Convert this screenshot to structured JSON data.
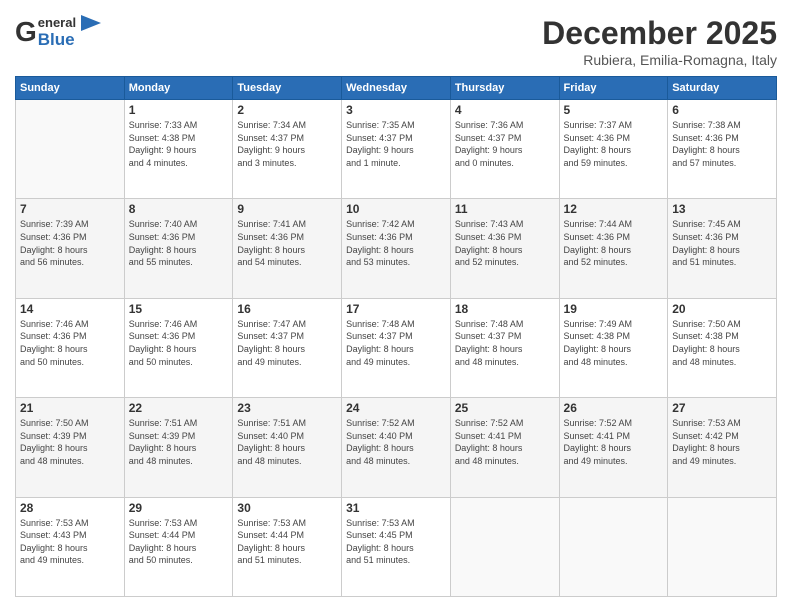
{
  "logo": {
    "g": "G",
    "eneral": "eneral",
    "blue": "Blue"
  },
  "title": "December 2025",
  "subtitle": "Rubiera, Emilia-Romagna, Italy",
  "days_header": [
    "Sunday",
    "Monday",
    "Tuesday",
    "Wednesday",
    "Thursday",
    "Friday",
    "Saturday"
  ],
  "weeks": [
    [
      {
        "num": "",
        "info": ""
      },
      {
        "num": "1",
        "info": "Sunrise: 7:33 AM\nSunset: 4:38 PM\nDaylight: 9 hours\nand 4 minutes."
      },
      {
        "num": "2",
        "info": "Sunrise: 7:34 AM\nSunset: 4:37 PM\nDaylight: 9 hours\nand 3 minutes."
      },
      {
        "num": "3",
        "info": "Sunrise: 7:35 AM\nSunset: 4:37 PM\nDaylight: 9 hours\nand 1 minute."
      },
      {
        "num": "4",
        "info": "Sunrise: 7:36 AM\nSunset: 4:37 PM\nDaylight: 9 hours\nand 0 minutes."
      },
      {
        "num": "5",
        "info": "Sunrise: 7:37 AM\nSunset: 4:36 PM\nDaylight: 8 hours\nand 59 minutes."
      },
      {
        "num": "6",
        "info": "Sunrise: 7:38 AM\nSunset: 4:36 PM\nDaylight: 8 hours\nand 57 minutes."
      }
    ],
    [
      {
        "num": "7",
        "info": "Sunrise: 7:39 AM\nSunset: 4:36 PM\nDaylight: 8 hours\nand 56 minutes."
      },
      {
        "num": "8",
        "info": "Sunrise: 7:40 AM\nSunset: 4:36 PM\nDaylight: 8 hours\nand 55 minutes."
      },
      {
        "num": "9",
        "info": "Sunrise: 7:41 AM\nSunset: 4:36 PM\nDaylight: 8 hours\nand 54 minutes."
      },
      {
        "num": "10",
        "info": "Sunrise: 7:42 AM\nSunset: 4:36 PM\nDaylight: 8 hours\nand 53 minutes."
      },
      {
        "num": "11",
        "info": "Sunrise: 7:43 AM\nSunset: 4:36 PM\nDaylight: 8 hours\nand 52 minutes."
      },
      {
        "num": "12",
        "info": "Sunrise: 7:44 AM\nSunset: 4:36 PM\nDaylight: 8 hours\nand 52 minutes."
      },
      {
        "num": "13",
        "info": "Sunrise: 7:45 AM\nSunset: 4:36 PM\nDaylight: 8 hours\nand 51 minutes."
      }
    ],
    [
      {
        "num": "14",
        "info": "Sunrise: 7:46 AM\nSunset: 4:36 PM\nDaylight: 8 hours\nand 50 minutes."
      },
      {
        "num": "15",
        "info": "Sunrise: 7:46 AM\nSunset: 4:36 PM\nDaylight: 8 hours\nand 50 minutes."
      },
      {
        "num": "16",
        "info": "Sunrise: 7:47 AM\nSunset: 4:37 PM\nDaylight: 8 hours\nand 49 minutes."
      },
      {
        "num": "17",
        "info": "Sunrise: 7:48 AM\nSunset: 4:37 PM\nDaylight: 8 hours\nand 49 minutes."
      },
      {
        "num": "18",
        "info": "Sunrise: 7:48 AM\nSunset: 4:37 PM\nDaylight: 8 hours\nand 48 minutes."
      },
      {
        "num": "19",
        "info": "Sunrise: 7:49 AM\nSunset: 4:38 PM\nDaylight: 8 hours\nand 48 minutes."
      },
      {
        "num": "20",
        "info": "Sunrise: 7:50 AM\nSunset: 4:38 PM\nDaylight: 8 hours\nand 48 minutes."
      }
    ],
    [
      {
        "num": "21",
        "info": "Sunrise: 7:50 AM\nSunset: 4:39 PM\nDaylight: 8 hours\nand 48 minutes."
      },
      {
        "num": "22",
        "info": "Sunrise: 7:51 AM\nSunset: 4:39 PM\nDaylight: 8 hours\nand 48 minutes."
      },
      {
        "num": "23",
        "info": "Sunrise: 7:51 AM\nSunset: 4:40 PM\nDaylight: 8 hours\nand 48 minutes."
      },
      {
        "num": "24",
        "info": "Sunrise: 7:52 AM\nSunset: 4:40 PM\nDaylight: 8 hours\nand 48 minutes."
      },
      {
        "num": "25",
        "info": "Sunrise: 7:52 AM\nSunset: 4:41 PM\nDaylight: 8 hours\nand 48 minutes."
      },
      {
        "num": "26",
        "info": "Sunrise: 7:52 AM\nSunset: 4:41 PM\nDaylight: 8 hours\nand 49 minutes."
      },
      {
        "num": "27",
        "info": "Sunrise: 7:53 AM\nSunset: 4:42 PM\nDaylight: 8 hours\nand 49 minutes."
      }
    ],
    [
      {
        "num": "28",
        "info": "Sunrise: 7:53 AM\nSunset: 4:43 PM\nDaylight: 8 hours\nand 49 minutes."
      },
      {
        "num": "29",
        "info": "Sunrise: 7:53 AM\nSunset: 4:44 PM\nDaylight: 8 hours\nand 50 minutes."
      },
      {
        "num": "30",
        "info": "Sunrise: 7:53 AM\nSunset: 4:44 PM\nDaylight: 8 hours\nand 51 minutes."
      },
      {
        "num": "31",
        "info": "Sunrise: 7:53 AM\nSunset: 4:45 PM\nDaylight: 8 hours\nand 51 minutes."
      },
      {
        "num": "",
        "info": ""
      },
      {
        "num": "",
        "info": ""
      },
      {
        "num": "",
        "info": ""
      }
    ]
  ]
}
